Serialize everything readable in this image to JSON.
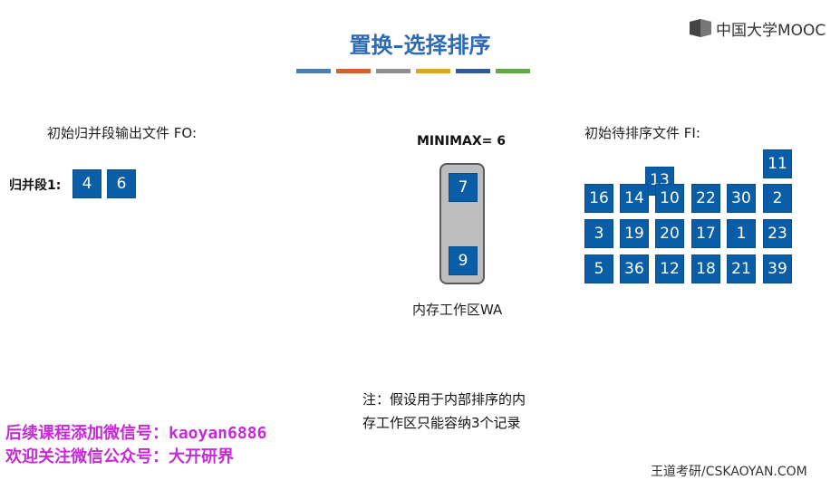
{
  "logo": {
    "text": "中国大学MOOC",
    "icon": "mooc-logo-icon"
  },
  "title": "置换–选择排序",
  "title_bar_colors": [
    "#4a7fb6",
    "#d2622a",
    "#8f8f8f",
    "#d9a62b",
    "#2f5a9a",
    "#5fa845"
  ],
  "output_file": {
    "label": "初始归并段输出文件 FO:",
    "run_label": "归并段1:",
    "values": [
      "4",
      "6"
    ]
  },
  "minimax": "MINIMAX= 6",
  "work_area": {
    "label": "内存工作区WA",
    "values": [
      "7",
      "9"
    ]
  },
  "input_file": {
    "label": "初始待排序文件 FI:",
    "values": [
      "11",
      "13",
      "16",
      "14",
      "10",
      "22",
      "30",
      "2",
      "3",
      "19",
      "20",
      "17",
      "1",
      "23",
      "5",
      "36",
      "12",
      "18",
      "21",
      "39"
    ]
  },
  "note": {
    "line1": "注：假设用于内部排序的内",
    "line2": "存工作区只能容纳3个记录"
  },
  "promo": {
    "line1": "后续课程添加微信号：kaoyan6886",
    "line2": "欢迎关注微信公众号：大开研界"
  },
  "footer": "王道考研/CSKAOYAN.COM",
  "colors": {
    "block": "#0a5ea8",
    "title": "#2e6bb5",
    "promo": "#c72bd8"
  }
}
